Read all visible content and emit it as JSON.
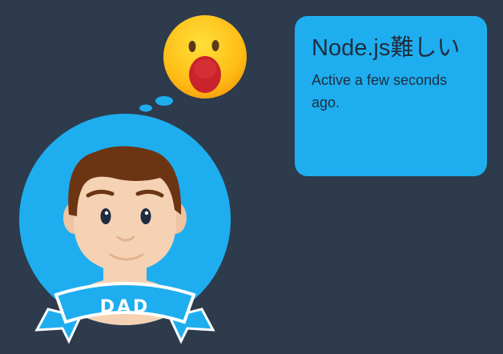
{
  "status_card": {
    "title": "Node.js難しい",
    "subtitle": "Active a few seconds ago."
  },
  "avatar": {
    "badge_label": "DAD"
  },
  "emoji": {
    "icon": "astonished-face-emoji"
  },
  "colors": {
    "background": "#2d3b4d",
    "accent_blue": "#1eaeef",
    "card_text": "#1f2d3f",
    "emoji_yellow": "#ffc417",
    "emoji_mouth": "#c9232b"
  }
}
